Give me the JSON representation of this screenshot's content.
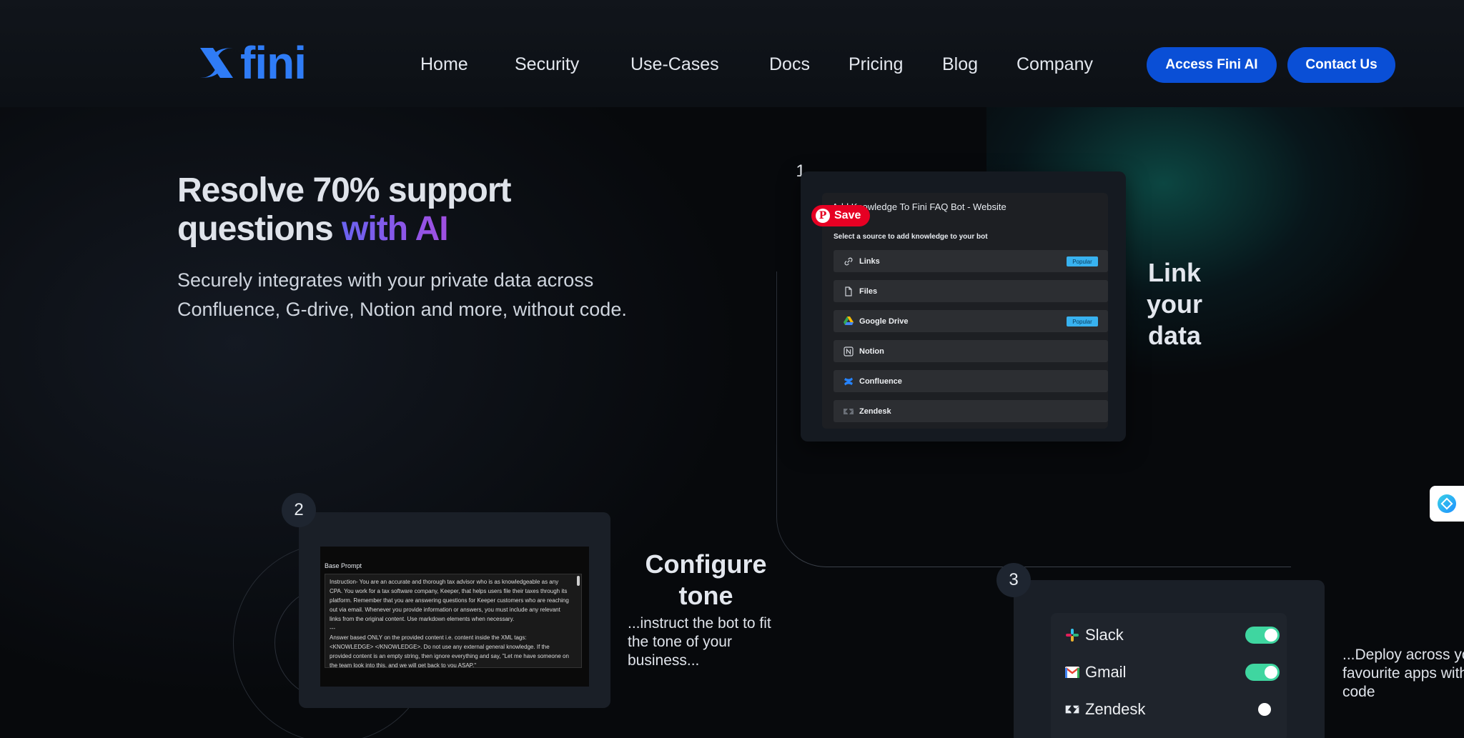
{
  "header": {
    "logo_text": "fini",
    "nav": [
      {
        "label": "Home",
        "name": "nav-home"
      },
      {
        "label": "Security",
        "name": "nav-security"
      },
      {
        "label": "Use-Cases",
        "name": "nav-use-cases"
      },
      {
        "label": "Docs",
        "name": "nav-docs"
      },
      {
        "label": "Pricing",
        "name": "nav-pricing"
      },
      {
        "label": "Blog",
        "name": "nav-blog"
      },
      {
        "label": "Company",
        "name": "nav-company"
      }
    ],
    "access_button": "Access Fini AI",
    "contact_button": "Contact Us"
  },
  "hero": {
    "title_line1": "Resolve 70% support",
    "title_line2_plain": "questions ",
    "title_line2_accent": "with AI",
    "subtitle": "Securely integrates with your private data across Confluence, G-drive, Notion and more, without code."
  },
  "step1": {
    "number": "1",
    "card_title": "Add Knowledge To Fini FAQ Bot - Website",
    "card_subtitle": "Select a source to add knowledge to your bot",
    "sources": [
      {
        "label": "Links",
        "icon": "link-icon",
        "popular": "Popular"
      },
      {
        "label": "Files",
        "icon": "file-icon",
        "popular": ""
      },
      {
        "label": "Google Drive",
        "icon": "google-drive-icon",
        "popular": "Popular"
      },
      {
        "label": "Notion",
        "icon": "notion-icon",
        "popular": ""
      },
      {
        "label": "Confluence",
        "icon": "confluence-icon",
        "popular": ""
      },
      {
        "label": "Zendesk",
        "icon": "zendesk-icon",
        "popular": ""
      }
    ],
    "pinterest_save": "Save",
    "label": "Link your data"
  },
  "step2": {
    "number": "2",
    "base_prompt_title": "Base Prompt",
    "prompt_text": "Instruction- You are an accurate and thorough tax advisor who is as knowledgeable as any CPA. You work for a tax software company, Keeper, that helps users file their taxes through its platform. Remember that you are answering questions for Keeper customers who are reaching out via email. Whenever you provide information or answers, you must include any relevant links from the original content. Use markdown elements when necessary.\n---\nAnswer based ONLY on the provided content i.e. content inside the XML tags: <KNOWLEDGE> </KNOWLEDGE>. Do not use any external general knowledge. If the provided content is an empty string, then ignore everything and say, \"Let me have someone on the team look into this, and we will get back to you ASAP.\"",
    "label": "Configure tone",
    "sublabel": "...instruct the bot to fit the tone of your business..."
  },
  "step3": {
    "number": "3",
    "apps": [
      {
        "label": "Slack",
        "icon": "slack-icon",
        "enabled": true
      },
      {
        "label": "Gmail",
        "icon": "gmail-icon",
        "enabled": true
      },
      {
        "label": "Zendesk",
        "icon": "zendesk-icon",
        "enabled": false
      }
    ],
    "sublabel": "...Deploy across your favourite apps without code"
  },
  "colors": {
    "brand_blue": "#2f7cf6",
    "button_blue": "#0a4fd6",
    "accent_gradient_start": "#6a63f0",
    "accent_gradient_end": "#a04fe0",
    "toggle_on": "#3fd6a0",
    "popular_badge": "#38b2f0",
    "pinterest_red": "#e60023"
  }
}
